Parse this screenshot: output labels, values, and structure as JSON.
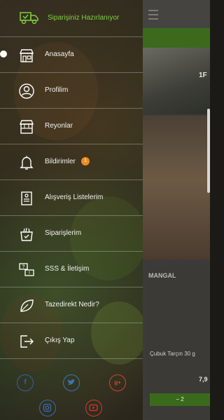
{
  "header": {
    "status_text": "Siparişiniz Hazırlanıyor",
    "icon": "delivery-truck-icon",
    "accent": "#7fcf3e"
  },
  "menu": {
    "items": [
      {
        "label": "Anasayfa",
        "icon": "store-icon",
        "active": true
      },
      {
        "label": "Profilim",
        "icon": "profile-icon"
      },
      {
        "label": "Reyonlar",
        "icon": "shelves-icon"
      },
      {
        "label": "Bildirimler",
        "icon": "bell-icon",
        "badge": "1"
      },
      {
        "label": "Alışveriş Listelerim",
        "icon": "shopping-list-icon"
      },
      {
        "label": "Siparişlerim",
        "icon": "orders-bag-icon"
      },
      {
        "label": "SSS & İletişim",
        "icon": "faq-chat-icon"
      },
      {
        "label": "Tazedirekt Nedir?",
        "icon": "leaf-icon"
      },
      {
        "label": "Çıkış Yap",
        "icon": "logout-icon"
      }
    ]
  },
  "social": {
    "facebook": "f",
    "twitter": "twitter-icon",
    "googleplus": "g+",
    "instagram": "instagram-icon",
    "youtube": "youtube-icon",
    "colors": {
      "facebook": "#3b5ea8",
      "twitter": "#3b75b5",
      "googleplus": "#d3452d",
      "instagram": "#3b6ab0",
      "youtube": "#d43a2a"
    }
  },
  "background_app": {
    "section_label": "MANGAL",
    "product_name": "Çubuk Tarçın 30 g",
    "price": "7,9",
    "number": "1F",
    "cart_label": "−    2"
  }
}
